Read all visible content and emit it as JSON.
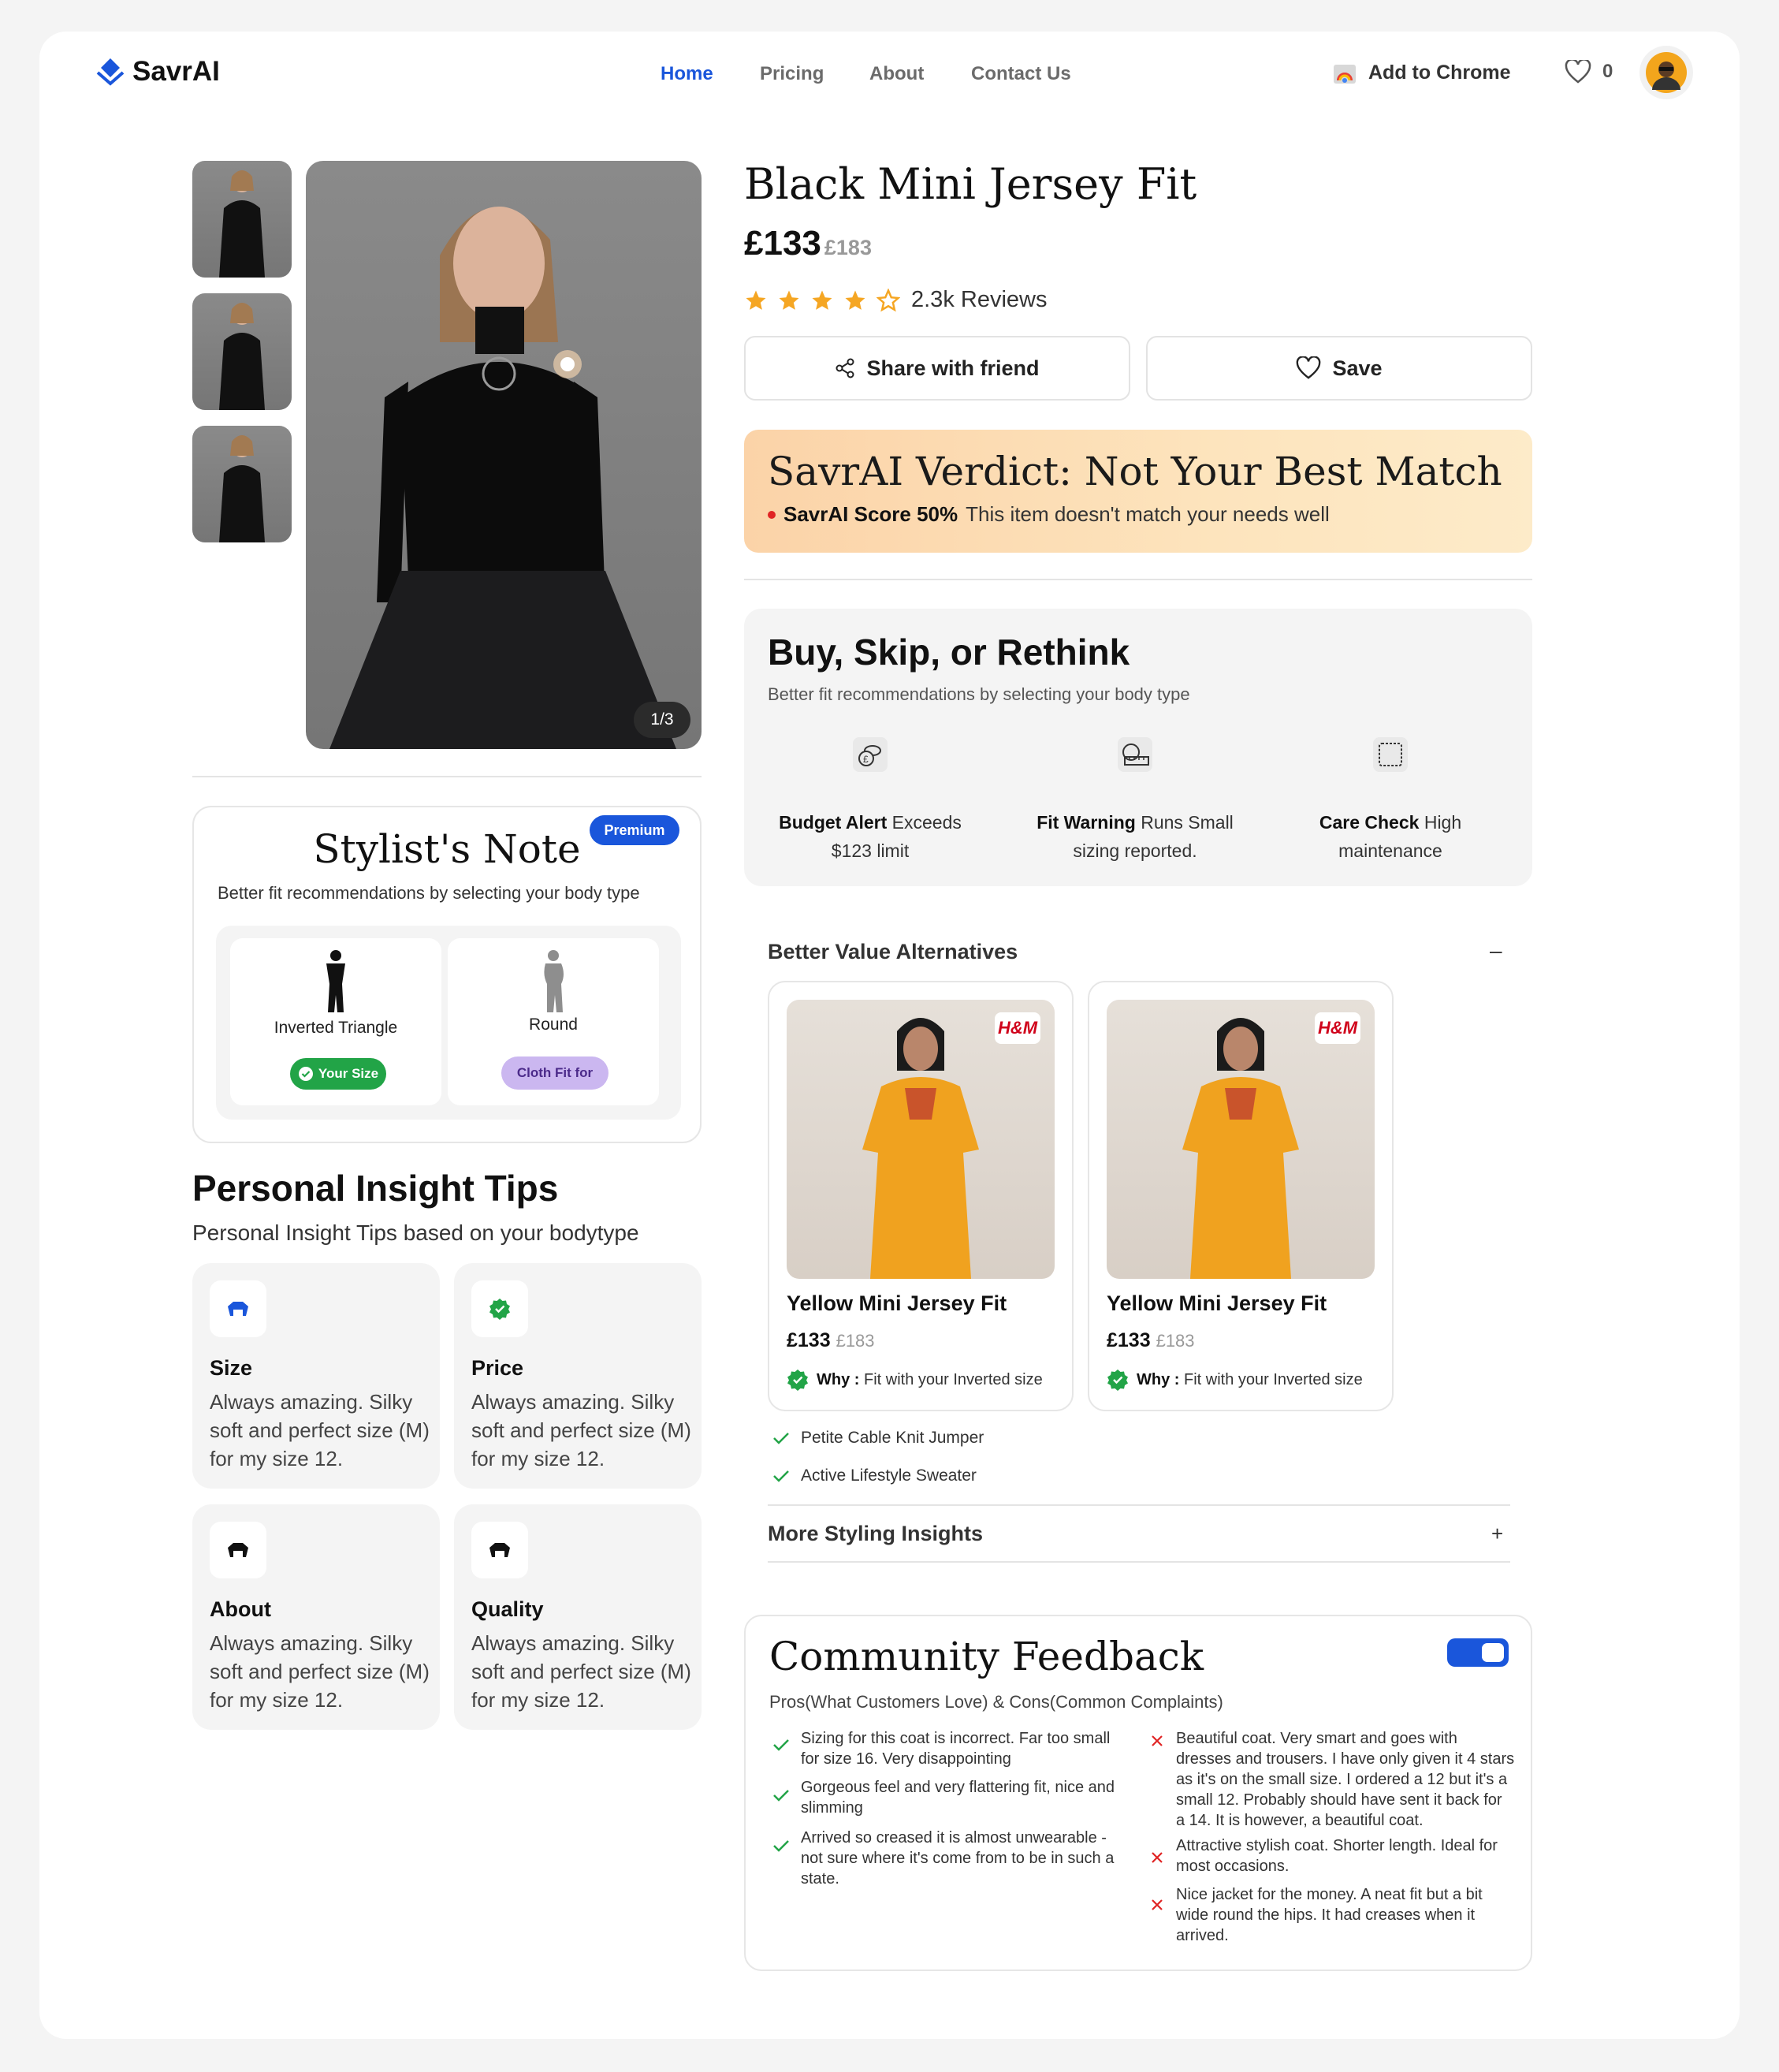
{
  "brand": {
    "name": "SavrAI"
  },
  "nav": {
    "home": "Home",
    "pricing": "Pricing",
    "about": "About",
    "contact": "Contact Us"
  },
  "header": {
    "add_to_chrome": "Add to Chrome",
    "wishlist_count": "0"
  },
  "gallery": {
    "counter": "1/3"
  },
  "product": {
    "title": "Black Mini Jersey Fit",
    "price": "£133",
    "old_price": "£183",
    "rating": 4,
    "reviews": "2.3k Reviews",
    "share_label": "Share with friend",
    "save_label": "Save"
  },
  "verdict": {
    "title": "SavrAI Verdict: Not Your Best Match",
    "score": "SavrAI Score 50%",
    "text": "This item doesn't match your needs well"
  },
  "decision": {
    "title": "Buy, Skip, or Rethink",
    "subtitle": "Better fit recommendations by selecting your body type",
    "items": [
      {
        "bold": "Budget Alert",
        "text": " Exceeds",
        "line2": "$123 limit",
        "icon": "money-icon"
      },
      {
        "bold": "Fit Warning",
        "text": " Runs Small",
        "line2": "sizing reported.",
        "icon": "measuring-tape-icon"
      },
      {
        "bold": "Care Check",
        "text": " High",
        "line2": "maintenance",
        "icon": "fabric-icon"
      }
    ]
  },
  "stylist": {
    "title": "Stylist's Note",
    "badge": "Premium",
    "subtitle": "Better fit recommendations by selecting your body type",
    "body_types": [
      {
        "label": "Inverted Triangle",
        "tag": "Your Size"
      },
      {
        "label": "Round",
        "tag": "Cloth Fit for"
      }
    ]
  },
  "tips": {
    "title": "Personal Insight Tips",
    "subtitle": "Personal Insight Tips based on your bodytype",
    "items": [
      {
        "title": "Size",
        "text": "Always amazing. Silky soft and perfect size (M) for my size 12."
      },
      {
        "title": "Price",
        "text": "Always amazing. Silky soft and perfect size (M) for my size 12."
      },
      {
        "title": "About",
        "text": "Always amazing. Silky soft and perfect size (M) for my size 12."
      },
      {
        "title": "Quality",
        "text": "Always amazing. Silky soft and perfect size (M) for my size 12."
      }
    ]
  },
  "alternatives": {
    "title": "Better Value Alternatives",
    "collapse": "–",
    "items": [
      {
        "brand": "H&M",
        "name": "Yellow Mini Jersey Fit",
        "price": "£133",
        "old_price": "£183",
        "why_label": "Why :",
        "why": "Fit with your Inverted size"
      },
      {
        "brand": "H&M",
        "name": "Yellow Mini Jersey Fit",
        "price": "£133",
        "old_price": "£183",
        "why_label": "Why :",
        "why": "Fit with your Inverted size"
      }
    ],
    "checks": [
      "Petite Cable Knit Jumper",
      "Active Lifestyle Sweater"
    ],
    "more": "More Styling Insights",
    "expand": "+"
  },
  "community": {
    "title": "Community Feedback",
    "subtitle": "Pros(What Customers Love) & Cons(Common Complaints)",
    "toggle_on": true,
    "pros": [
      "Sizing for this coat is incorrect. Far too small for size 16. Very disappointing",
      "Gorgeous feel and very flattering fit, nice and slimming",
      "Arrived so creased it is almost unwearable - not sure where it's come from to be in such a state."
    ],
    "cons": [
      "Beautiful coat. Very smart and goes with dresses and trousers. I have only given it 4 stars as it's on the small size. I ordered a 12 but it's a small 12. Probably should have sent it back for a 14. It is however, a beautiful coat.",
      "Attractive stylish coat. Shorter length. Ideal for most occasions.",
      "Nice jacket for the money. A neat fit but a bit wide round the hips. It had creases when it arrived."
    ]
  },
  "colors": {
    "accent": "#1a56db",
    "green": "#22a447",
    "red": "#e02424",
    "purple_tag": "#cbb7f0"
  }
}
